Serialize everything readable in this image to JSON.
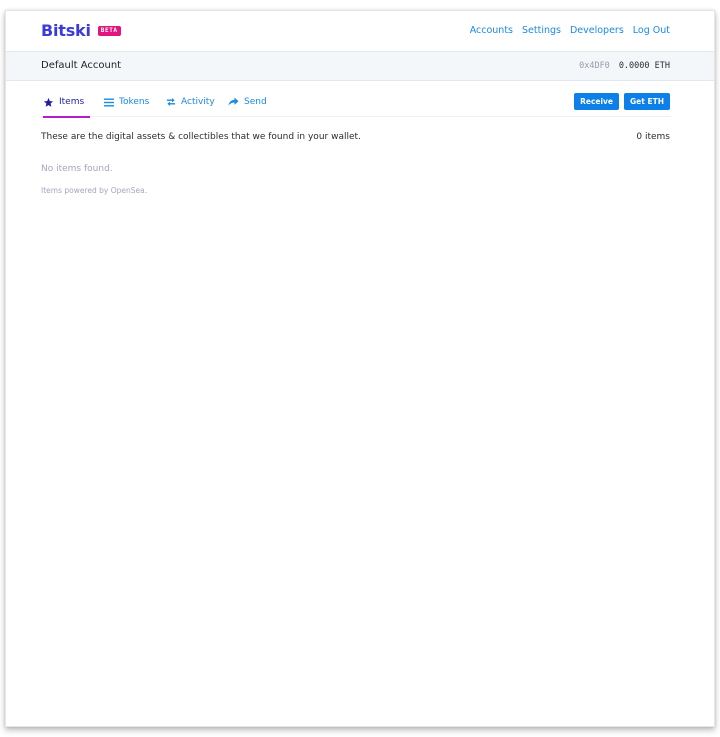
{
  "brand": {
    "name": "Bitski",
    "badge": "BETA",
    "colors": {
      "name": "#3b3bd9",
      "badge": "#e0157d"
    }
  },
  "nav": {
    "items": [
      {
        "label": "Accounts"
      },
      {
        "label": "Settings"
      },
      {
        "label": "Developers"
      },
      {
        "label": "Log Out"
      }
    ],
    "link_color": "#1a8ae6"
  },
  "account": {
    "name": "Default Account",
    "address": "0x4DF0",
    "balance": "0.0000 ETH"
  },
  "tabs": [
    {
      "label": "Items",
      "icon": "star-icon",
      "active": true
    },
    {
      "label": "Tokens",
      "icon": "list-icon",
      "active": false
    },
    {
      "label": "Activity",
      "icon": "arrows-swap-icon",
      "active": false
    },
    {
      "label": "Send",
      "icon": "share-arrow-icon",
      "active": false
    }
  ],
  "tab_colors": {
    "active": "#1f1f9e",
    "inactive": "#1a8ae6",
    "underline": "#b41ec8"
  },
  "actions": {
    "receive_label": "Receive",
    "get_eth_label": "Get ETH",
    "button_color": "#0d7fe8"
  },
  "content": {
    "description": "These are the digital assets & collectibles that we found in your wallet.",
    "item_count": "0 items",
    "empty_message": "No items found.",
    "powered_by": "Items powered by OpenSea."
  }
}
